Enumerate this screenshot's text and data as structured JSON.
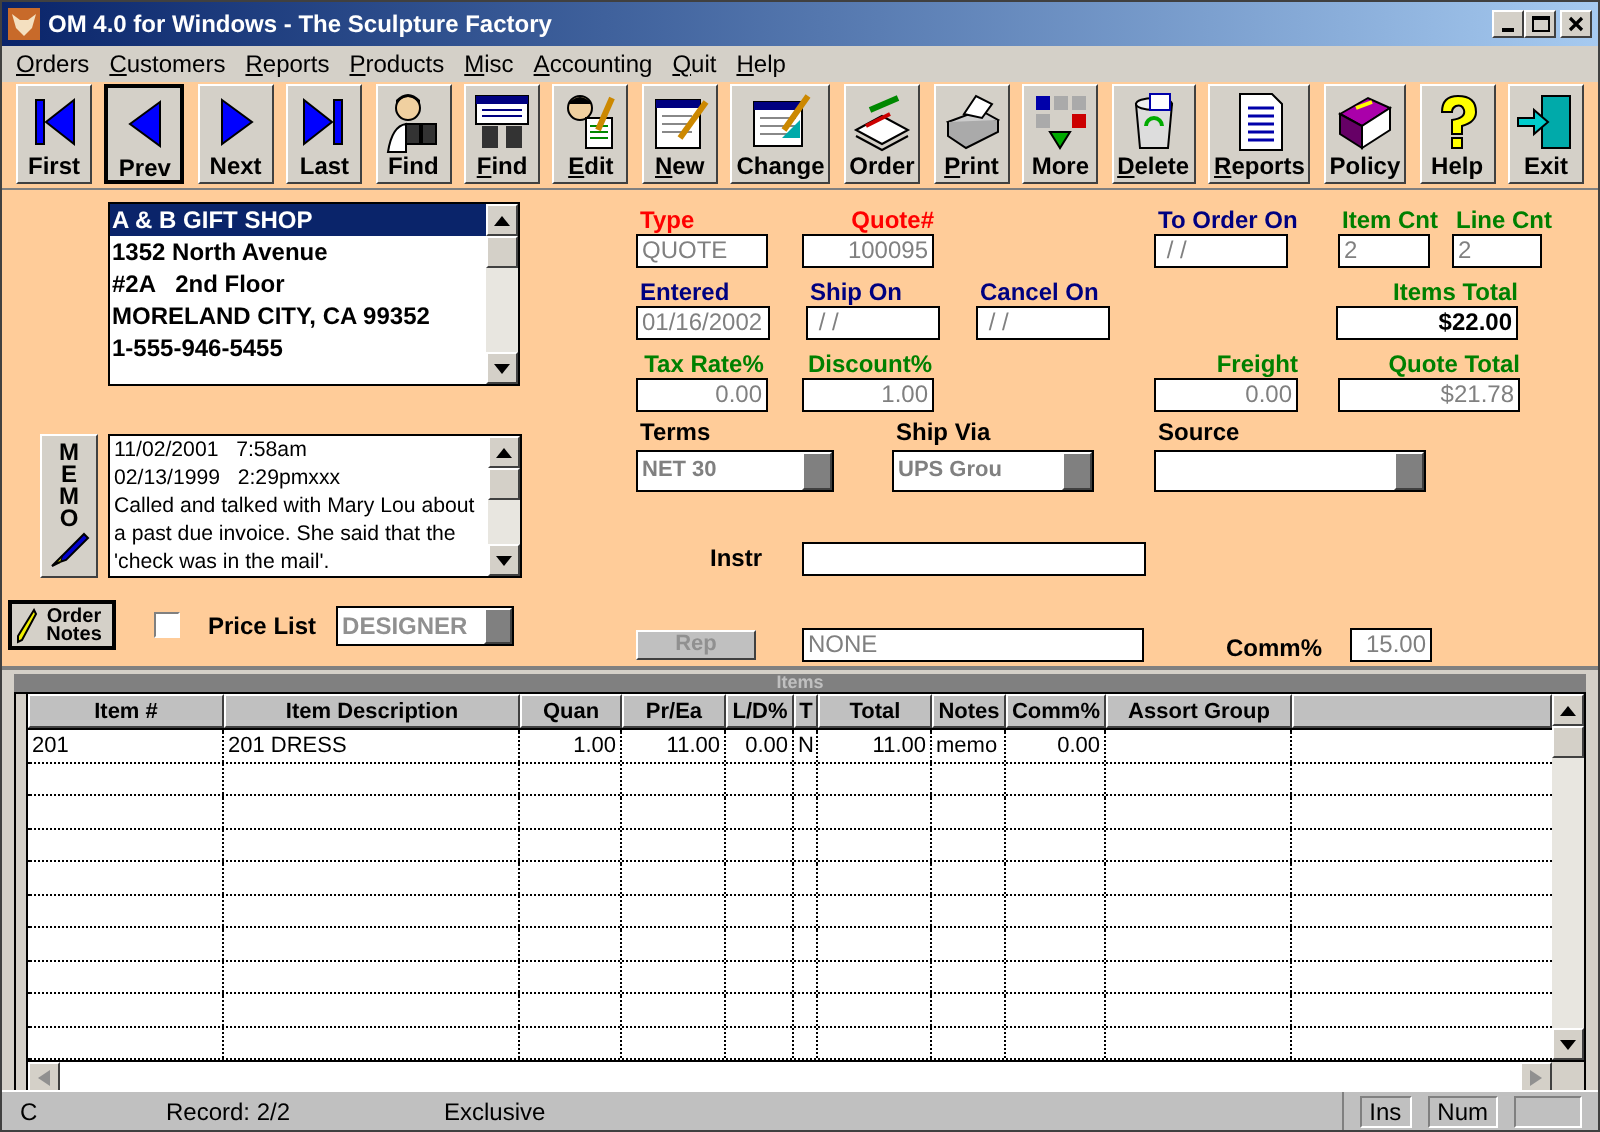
{
  "window": {
    "title": "OM 4.0 for Windows - The Sculpture Factory"
  },
  "menu": [
    "Orders",
    "Customers",
    "Reports",
    "Products",
    "Misc",
    "Accounting",
    "Quit",
    "Help"
  ],
  "toolbar": [
    {
      "label": "First",
      "kind": "first",
      "underline": false,
      "selected": false
    },
    {
      "label": "Prev",
      "kind": "prev",
      "underline": false,
      "selected": true
    },
    {
      "label": "Next",
      "kind": "next",
      "underline": false,
      "selected": false
    },
    {
      "label": "Last",
      "kind": "last",
      "underline": false,
      "selected": false
    },
    {
      "label": "Find",
      "kind": "find_person",
      "underline": false,
      "selected": false
    },
    {
      "label": "Find",
      "kind": "find_list",
      "underline": true,
      "selected": false
    },
    {
      "label": "Edit",
      "kind": "edit",
      "underline": true,
      "selected": false
    },
    {
      "label": "New",
      "kind": "new",
      "underline": true,
      "selected": false
    },
    {
      "label": "Change",
      "kind": "change",
      "underline": false,
      "selected": false
    },
    {
      "label": "Order",
      "kind": "order",
      "underline": false,
      "selected": false
    },
    {
      "label": "Print",
      "kind": "print",
      "underline": true,
      "selected": false
    },
    {
      "label": "More",
      "kind": "more",
      "underline": false,
      "selected": false
    },
    {
      "label": "Delete",
      "kind": "delete",
      "underline": true,
      "selected": false
    },
    {
      "label": "Reports",
      "kind": "reports",
      "underline": true,
      "selected": false
    },
    {
      "label": "Policy",
      "kind": "policy",
      "underline": false,
      "selected": false
    },
    {
      "label": "Help",
      "kind": "help",
      "underline": false,
      "selected": false
    },
    {
      "label": "Exit",
      "kind": "exit",
      "underline": false,
      "selected": false
    }
  ],
  "address": [
    {
      "text": "A & B GIFT SHOP",
      "selected": true
    },
    {
      "text": "1352 North Avenue",
      "selected": false
    },
    {
      "text": "#2A   2nd Floor",
      "selected": false
    },
    {
      "text": "MORELAND CITY, CA 99352",
      "selected": false
    },
    {
      "text": "1-555-946-5455",
      "selected": false
    }
  ],
  "memo": {
    "button": "MEMO",
    "lines": [
      "11/02/2001   7:58am",
      "02/13/1999   2:29pmxxx",
      "Called and talked with Mary Lou about a past due invoice. She said that the 'check was in the mail'."
    ]
  },
  "order_notes": {
    "label": "Order Notes"
  },
  "price_list": {
    "label": "Price List",
    "checked": false,
    "value": "DESIGNER"
  },
  "rows": [
    [
      {
        "label": "Type",
        "value": "QUOTE",
        "color": "#ff0000",
        "disabled": true
      },
      {
        "label": "Quote#",
        "value": "100095",
        "color": "#ff0000",
        "disabled": true
      },
      {
        "label": "To Order On",
        "value": " / /",
        "color": "#000080",
        "disabled": true
      },
      {
        "label": "Item Cnt",
        "value": "2",
        "color": "#008000",
        "disabled": true
      },
      {
        "label": "Line Cnt",
        "value": "2",
        "color": "#008000",
        "disabled": true
      }
    ],
    [
      {
        "label": "Entered",
        "value": "01/16/2002",
        "color": "#000080",
        "disabled": true
      },
      {
        "label": "Ship On",
        "value": " / /",
        "color": "#000080",
        "disabled": true
      },
      {
        "label": "Cancel On",
        "value": " / /",
        "color": "#000080",
        "disabled": true
      },
      {
        "label": "Items Total",
        "value": "$22.00",
        "color": "#008000",
        "disabled": false
      }
    ],
    [
      {
        "label": "Tax Rate%",
        "value": "0.00",
        "color": "#008000",
        "disabled": true
      },
      {
        "label": "Discount%",
        "value": "1.00",
        "color": "#008000",
        "disabled": true
      },
      {
        "label": "Freight",
        "value": "0.00",
        "color": "#008000",
        "disabled": true
      },
      {
        "label": "Quote Total",
        "value": "$21.78",
        "color": "#008000",
        "disabled": true
      }
    ],
    [
      {
        "label": "Terms",
        "value": "NET 30",
        "color": "#000000",
        "disabled": true
      },
      {
        "label": "Ship Via",
        "value": "UPS Grou",
        "color": "#000000",
        "disabled": true
      },
      {
        "label": "Source",
        "color": "#000000"
      }
    ]
  ],
  "instr": {
    "label": "Instr"
  },
  "rep": {
    "button": "Rep",
    "disabled": true,
    "value": "NONE"
  },
  "comm": {
    "label": "Comm%",
    "value": "15.00"
  },
  "items": {
    "title": "Items",
    "columns": [
      "Item #",
      "Item Description",
      "Quan",
      "Pr/Ea",
      "L/D%",
      "T",
      "Total",
      "Notes",
      "Comm%",
      "Assort Group"
    ],
    "rows": [
      [
        "201",
        "201 DRESS",
        "1.00",
        "11.00",
        "0.00",
        "N",
        "11.00",
        "memo",
        "0.00",
        ""
      ]
    ]
  },
  "status_bar": {
    "mode": "C",
    "record": "Record: 2/2",
    "lock": "Exclusive",
    "indicators": [
      "Ins",
      "Num"
    ]
  }
}
